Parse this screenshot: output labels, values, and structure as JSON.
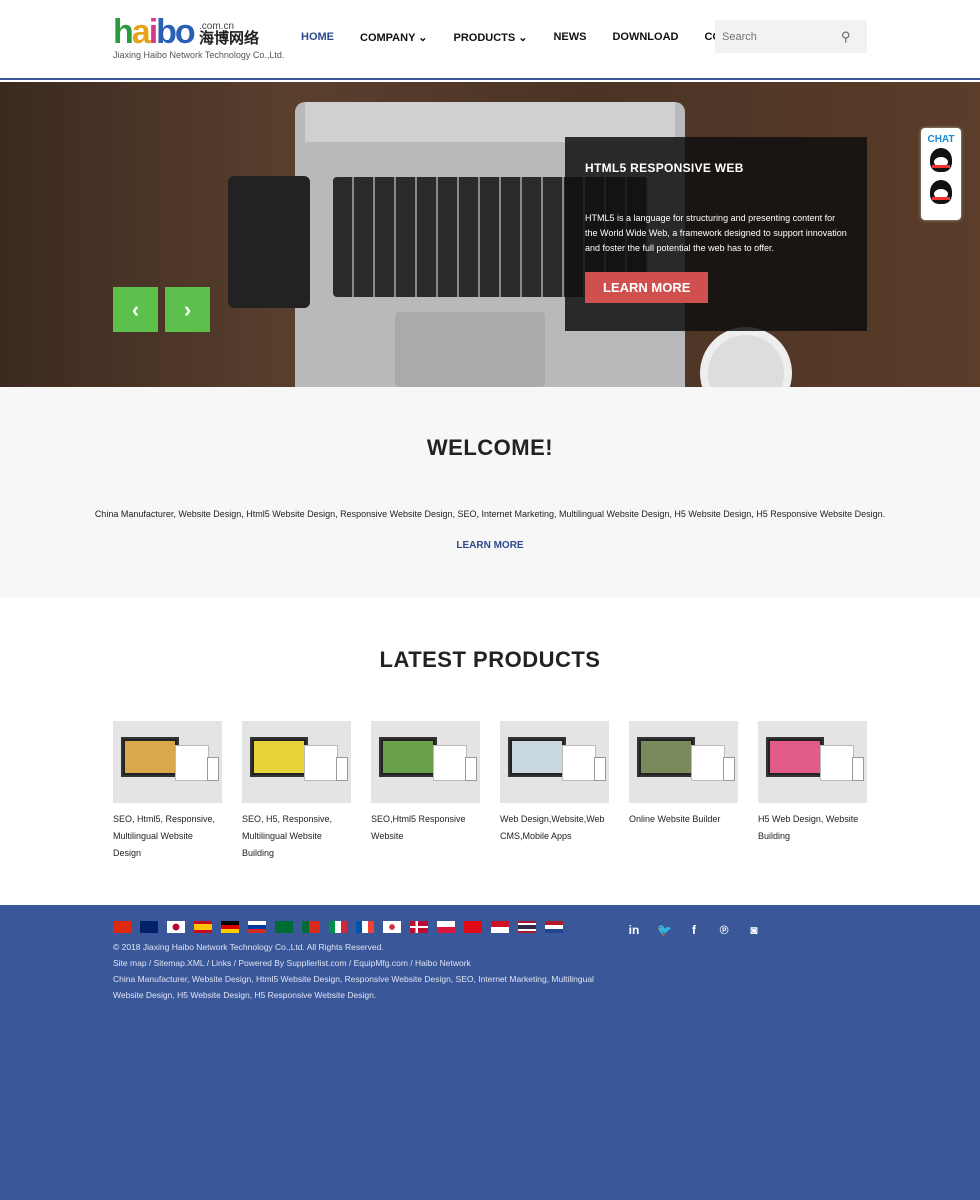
{
  "header": {
    "logo": {
      "letters": [
        "h",
        "a",
        "i",
        "bo"
      ],
      "domain": ".com.cn",
      "cn_name": "海博网络",
      "company": "Jiaxing Haibo Network Technology Co.,Ltd."
    },
    "nav": [
      {
        "label": "HOME",
        "active": true
      },
      {
        "label": "COMPANY ⌄"
      },
      {
        "label": "PRODUCTS ⌄"
      },
      {
        "label": "NEWS"
      },
      {
        "label": "DOWNLOAD"
      },
      {
        "label": "CONTACT"
      }
    ],
    "search": {
      "placeholder": "Search",
      "icon": "search-icon"
    }
  },
  "hero": {
    "title": "HTML5 RESPONSIVE WEB",
    "text": "HTML5 is a language for structuring and presenting content for the World Wide Web, a framework designed to support innovation and foster the full potential the web has to offer.",
    "button": "LEARN MORE",
    "prev": "‹",
    "next": "›"
  },
  "chat": {
    "label": "CHAT"
  },
  "welcome": {
    "title": "WELCOME!",
    "text": "China Manufacturer, Website Design, Html5 Website Design, Responsive Website Design, SEO, Internet Marketing, Multilingual Website Design, H5 Website Design, H5 Responsive Website Design.",
    "link": "LEARN MORE"
  },
  "products": {
    "title": "LATEST PRODUCTS",
    "items": [
      {
        "name": "SEO, Html5, Responsive, Multilingual Website Design",
        "color": "#d9a84a"
      },
      {
        "name": "SEO, H5, Responsive, Multilingual Website Building",
        "color": "#e8d43a"
      },
      {
        "name": "SEO,Html5 Responsive Website",
        "color": "#6aa04a"
      },
      {
        "name": "Web Design,Website,Web CMS,Mobile Apps",
        "color": "#c9d7df"
      },
      {
        "name": "Online Website Builder",
        "color": "#7b8a5c"
      },
      {
        "name": "H5 Web Design, Website Building",
        "color": "#e05a8a"
      }
    ]
  },
  "footer": {
    "flags": [
      "cn",
      "gb",
      "jp",
      "es",
      "de",
      "ru",
      "sa",
      "pt",
      "it",
      "fr",
      "kr",
      "no",
      "pl",
      "tr",
      "id",
      "th",
      "nl"
    ],
    "copyright": "© 2018 Jiaxing Haibo Network Technology Co.,Ltd. All Rights Reserved.",
    "links": "Site map / Sitemap.XML / Links / Powered By Supplierlist.com / EquipMfg.com / Haibo Network",
    "keywords": "China Manufacturer, Website Design, Html5 Website Design, Responsive Website Design, SEO, Internet Marketing, Multilingual Website Design, H5 Website Design, H5 Responsive Website Design.",
    "social": [
      {
        "icon": "linkedin-icon",
        "glyph": "in"
      },
      {
        "icon": "twitter-icon",
        "glyph": "🐦"
      },
      {
        "icon": "facebook-icon",
        "glyph": "f"
      },
      {
        "icon": "pinterest-icon",
        "glyph": "℗"
      },
      {
        "icon": "instagram-icon",
        "glyph": "◙"
      }
    ]
  },
  "colors": {
    "brand": "#3a5799",
    "accent_green": "#5cc04c",
    "button_red": "#d05050"
  }
}
